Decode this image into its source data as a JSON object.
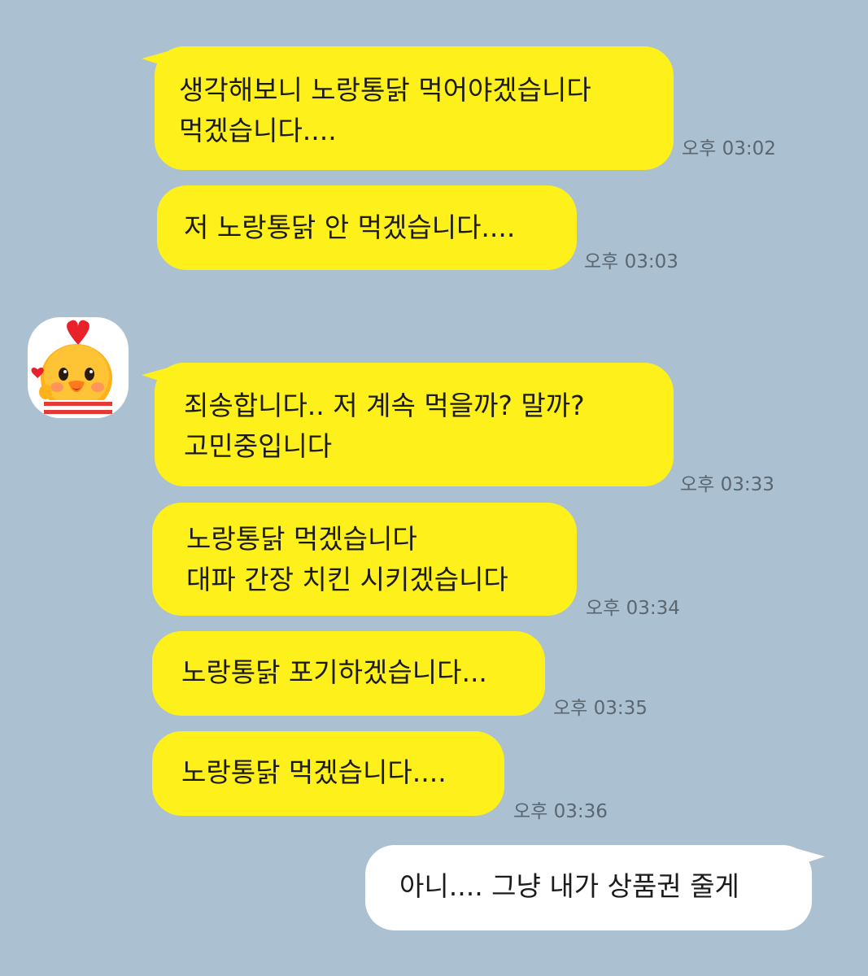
{
  "chat": {
    "colors": {
      "background": "#abc1d1",
      "incoming_bubble": "#fef01b",
      "outgoing_bubble": "#ffffff",
      "timestamp": "#5a6671"
    },
    "avatar_icon": "yellow-chick-mascot-icon",
    "messages": [
      {
        "sender": "other",
        "text": "생각해보니 노랑통닭 먹어야겠습니다\n먹겠습니다....",
        "time": "오후 03:02"
      },
      {
        "sender": "other",
        "text": "저 노랑통닭 안 먹겠습니다....",
        "time": "오후 03:03"
      },
      {
        "sender": "other",
        "text": "죄송합니다.. 저 계속 먹을까? 말까?\n고민중입니다",
        "time": "오후 03:33"
      },
      {
        "sender": "other",
        "text": "노랑통닭 먹겠습니다\n대파 간장 치킨 시키겠습니다",
        "time": "오후 03:34"
      },
      {
        "sender": "other",
        "text": "노랑통닭 포기하겠습니다...",
        "time": "오후 03:35"
      },
      {
        "sender": "other",
        "text": "노랑통닭 먹겠습니다....",
        "time": "오후 03:36"
      },
      {
        "sender": "me",
        "text": "아니.... 그냥 내가 상품권 줄게"
      }
    ]
  }
}
